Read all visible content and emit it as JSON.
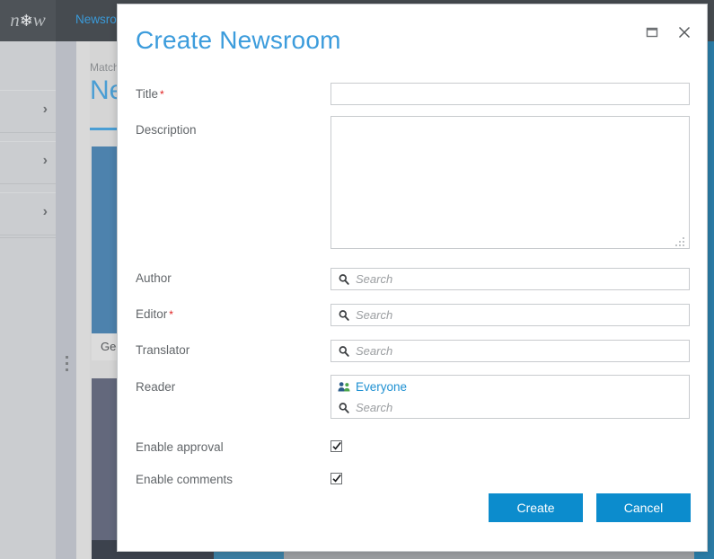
{
  "background": {
    "logo": {
      "left": "n",
      "flake": "❄",
      "right": "w"
    },
    "nav": [
      {
        "label": "Newsroom"
      }
    ],
    "sidebar": {
      "items": [
        {
          "label": "",
          "icon": "chevron-right-icon"
        },
        {
          "label": "",
          "icon": "chevron-right-icon"
        },
        {
          "label": "",
          "icon": "chevron-right-icon"
        }
      ]
    },
    "breadcrumb": "Match",
    "heading": "Ne",
    "tile_caption": "Gee"
  },
  "dialog": {
    "title": "Create Newsroom",
    "window_controls": {
      "maximize": "maximize-icon",
      "close": "close-icon"
    },
    "fields": {
      "title": {
        "label": "Title",
        "required": true,
        "value": "",
        "placeholder": ""
      },
      "description": {
        "label": "Description",
        "required": false,
        "value": "",
        "placeholder": ""
      },
      "author": {
        "label": "Author",
        "required": false,
        "placeholder": "Search",
        "icon": "search-icon"
      },
      "editor": {
        "label": "Editor",
        "required": true,
        "placeholder": "Search",
        "icon": "search-icon"
      },
      "translator": {
        "label": "Translator",
        "required": false,
        "placeholder": "Search",
        "icon": "search-icon"
      },
      "reader": {
        "label": "Reader",
        "required": false,
        "placeholder": "Search",
        "icon": "search-icon",
        "chips": [
          {
            "text": "Everyone",
            "icon": "people-icon"
          }
        ]
      }
    },
    "checkboxes": [
      {
        "label": "Enable approval",
        "checked": true
      },
      {
        "label": "Enable comments",
        "checked": true
      }
    ],
    "buttons": {
      "create": "Create",
      "cancel": "Cancel"
    },
    "required_marker": "*"
  },
  "colors": {
    "accent_blue": "#0c8ccd",
    "title_blue": "#3c9cdc",
    "chip_blue": "#1e90d2",
    "required_red": "#e02020",
    "topbar": "#464b50"
  }
}
